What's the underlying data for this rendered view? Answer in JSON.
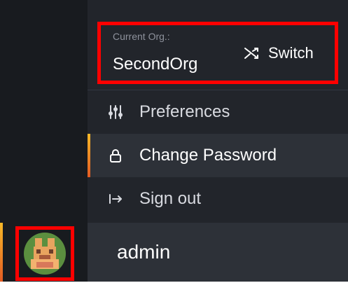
{
  "organization": {
    "caption": "Current Org.:",
    "name": "SecondOrg",
    "switch_label": "Switch"
  },
  "menu": {
    "items": [
      {
        "label": "Preferences",
        "icon": "sliders-icon"
      },
      {
        "label": "Change Password",
        "icon": "lock-icon"
      },
      {
        "label": "Sign out",
        "icon": "sign-out-icon"
      }
    ]
  },
  "user": {
    "name": "admin",
    "avatar_icon": "avatar-icon"
  },
  "colors": {
    "highlight": "#ff0000",
    "accent_top": "#f7b928",
    "accent_bottom": "#e35b23",
    "menu_bg": "#22252b",
    "active_bg": "#2d3138"
  }
}
